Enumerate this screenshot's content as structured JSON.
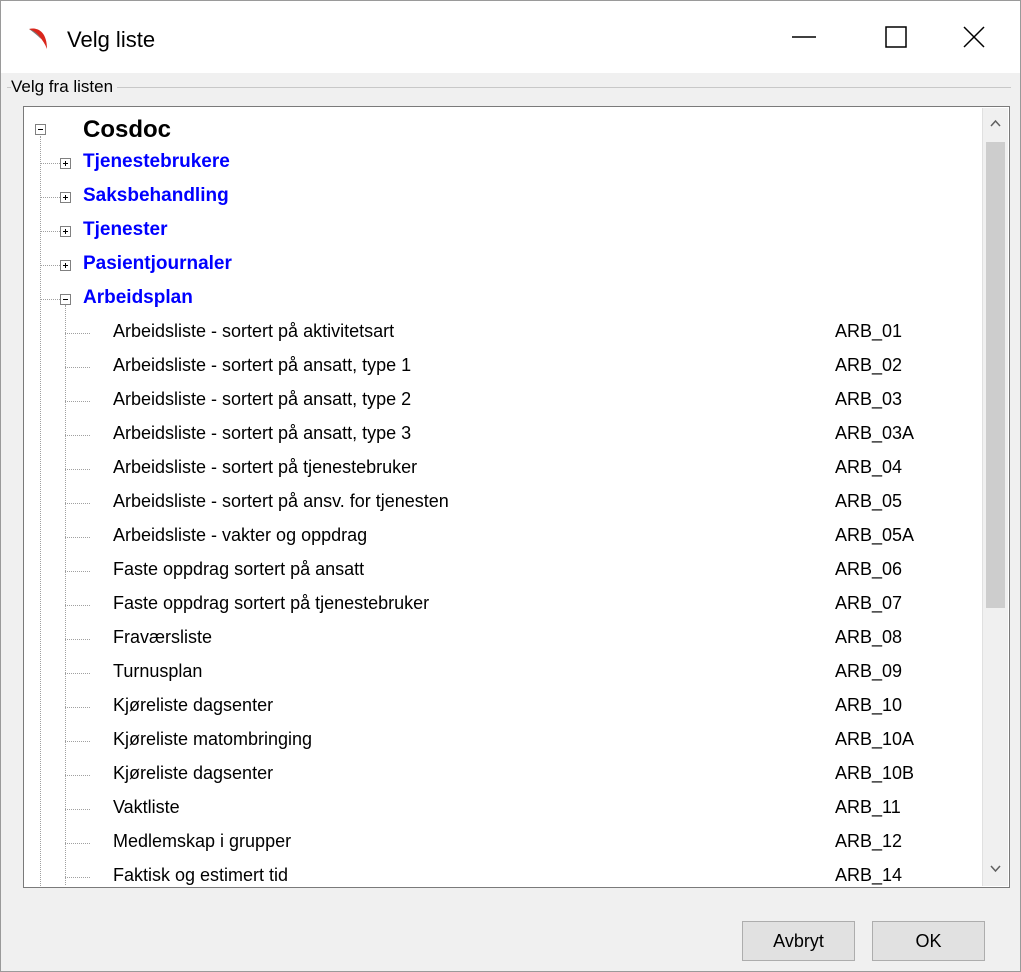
{
  "window": {
    "title": "Velg liste"
  },
  "group": {
    "label": "Velg fra listen"
  },
  "tree": {
    "root": "Cosdoc",
    "categories": [
      "Tjenestebrukere",
      "Saksbehandling",
      "Tjenester",
      "Pasientjournaler",
      "Arbeidsplan"
    ],
    "items": [
      {
        "name": "Arbeidsliste - sortert på aktivitetsart",
        "code": "ARB_01"
      },
      {
        "name": "Arbeidsliste - sortert på ansatt, type 1",
        "code": "ARB_02"
      },
      {
        "name": "Arbeidsliste - sortert på ansatt, type 2",
        "code": "ARB_03"
      },
      {
        "name": "Arbeidsliste - sortert på ansatt, type 3",
        "code": "ARB_03A"
      },
      {
        "name": "Arbeidsliste - sortert på tjenestebruker",
        "code": "ARB_04"
      },
      {
        "name": "Arbeidsliste - sortert på ansv. for tjenesten",
        "code": "ARB_05"
      },
      {
        "name": "Arbeidsliste - vakter og oppdrag",
        "code": "ARB_05A"
      },
      {
        "name": "Faste oppdrag sortert på ansatt",
        "code": "ARB_06"
      },
      {
        "name": "Faste oppdrag sortert på tjenestebruker",
        "code": "ARB_07"
      },
      {
        "name": "Fraværsliste",
        "code": "ARB_08"
      },
      {
        "name": "Turnusplan",
        "code": "ARB_09"
      },
      {
        "name": "Kjøreliste dagsenter",
        "code": "ARB_10"
      },
      {
        "name": "Kjøreliste matombringing",
        "code": "ARB_10A"
      },
      {
        "name": "Kjøreliste dagsenter",
        "code": "ARB_10B"
      },
      {
        "name": "Vaktliste",
        "code": "ARB_11"
      },
      {
        "name": "Medlemskap i grupper",
        "code": "ARB_12"
      },
      {
        "name": "Faktisk og estimert tid",
        "code": "ARB_14"
      }
    ]
  },
  "buttons": {
    "cancel": "Avbryt",
    "ok": "OK"
  },
  "colors": {
    "category": "#0000ff",
    "accent_icon": "#d9261c"
  }
}
